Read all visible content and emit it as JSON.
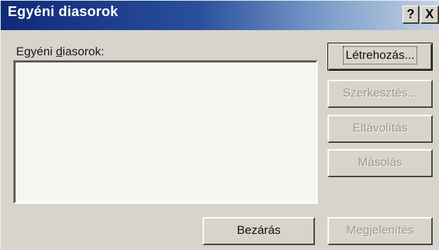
{
  "window": {
    "title": "Egyéni diasorok",
    "help_label": "?",
    "close_label": "X"
  },
  "list": {
    "label_prefix": "Egyéni ",
    "label_mnemonic": "d",
    "label_suffix": "iasorok:",
    "items": []
  },
  "buttons": {
    "create": {
      "label": "Létrehozás...",
      "enabled": true
    },
    "edit": {
      "label": "Szerkesztés...",
      "enabled": false
    },
    "remove": {
      "label": "Eltávolítás",
      "enabled": false
    },
    "copy": {
      "label": "Másolás",
      "enabled": false
    },
    "close": {
      "label": "Bezárás",
      "enabled": true
    },
    "show": {
      "label": "Megjelenítés",
      "enabled": false
    }
  },
  "colors": {
    "title_gradient_start": "#0e2a78",
    "title_gradient_end": "#c5d2e3",
    "dialog_face": "#d8d4cc",
    "disabled_text": "#9a978f"
  }
}
